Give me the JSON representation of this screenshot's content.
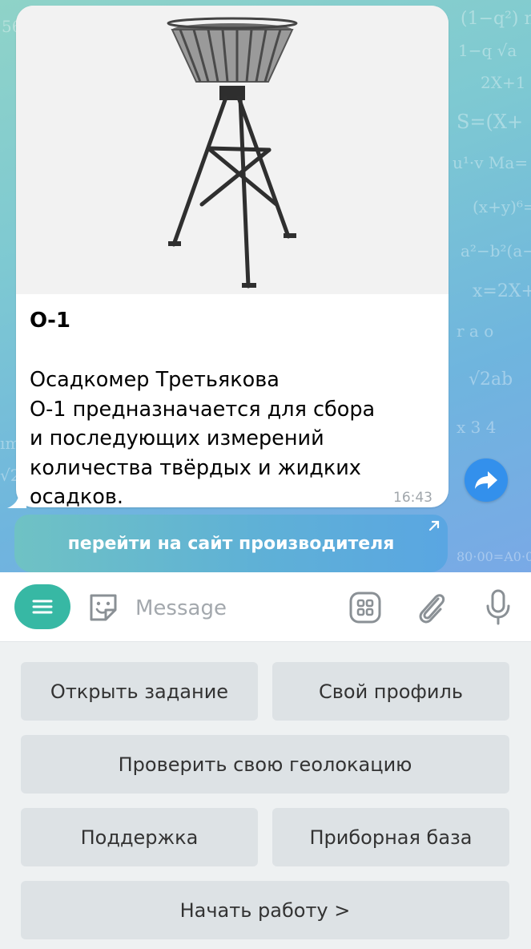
{
  "message": {
    "image_alt": "Осадкомер Третьякова О-1",
    "title": "О-1",
    "body": "Осадкомер Третьякова\nО-1 предназначается для сбора\nи последующих измерений\nколичества твёрдых и жидких\nосадков.",
    "time": "16:43"
  },
  "url_button": {
    "label": "перейти на сайт производителя"
  },
  "composer": {
    "placeholder": "Message"
  },
  "keyboard": {
    "open_task": "Открыть задание",
    "own_profile": "Свой профиль",
    "check_geo": "Проверить свою геолокацию",
    "support": "Поддержка",
    "instrument_base": "Приборная база",
    "start_work": "Начать работу >"
  },
  "colors": {
    "accent": "#37b8a4",
    "share": "#3390ec",
    "keyboard_button": "#dde2e5"
  }
}
